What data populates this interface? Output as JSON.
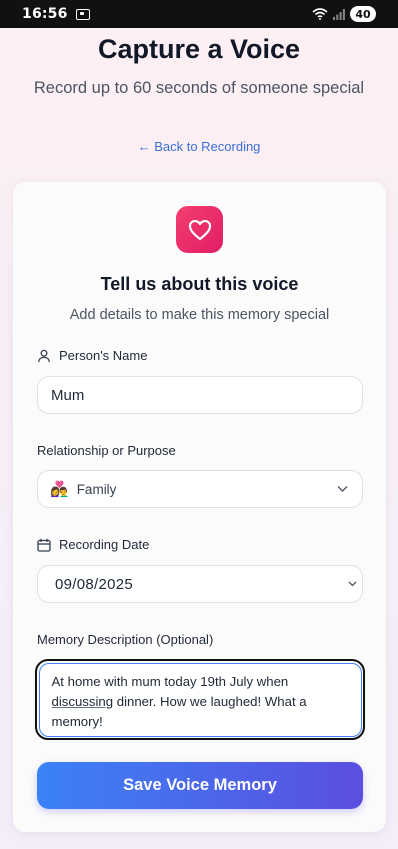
{
  "status_bar": {
    "time": "16:56",
    "battery": "40"
  },
  "header": {
    "title": "Capture a Voice",
    "subtitle": "Record up to 60 seconds of someone special",
    "back_link": "← Back to Recording"
  },
  "card": {
    "title": "Tell us about this voice",
    "subtitle": "Add details to make this memory special",
    "fields": {
      "name": {
        "label": "Person's Name",
        "value": "Mum"
      },
      "relationship": {
        "label": "Relationship or Purpose",
        "emoji": "👩‍❤️‍👨",
        "value": "Family"
      },
      "date": {
        "label": "Recording Date",
        "value": "09/08/2025"
      },
      "description": {
        "label": "Memory Description (Optional)",
        "text_before": "At home with mum today 19th July when ",
        "text_underlined": "discussing",
        "text_after": " dinner. How we laughed! What a memory!"
      }
    },
    "save_button": "Save Voice Memory"
  },
  "colors": {
    "accent_pink": "#e11d66",
    "link_blue": "#3b6fd8",
    "button_gradient_start": "#3b82f6",
    "button_gradient_end": "#5b4ee0"
  },
  "icons": [
    "cast-icon",
    "wifi-icon",
    "signal-icon",
    "heart-icon",
    "person-icon",
    "calendar-icon",
    "chevron-down-icon"
  ]
}
